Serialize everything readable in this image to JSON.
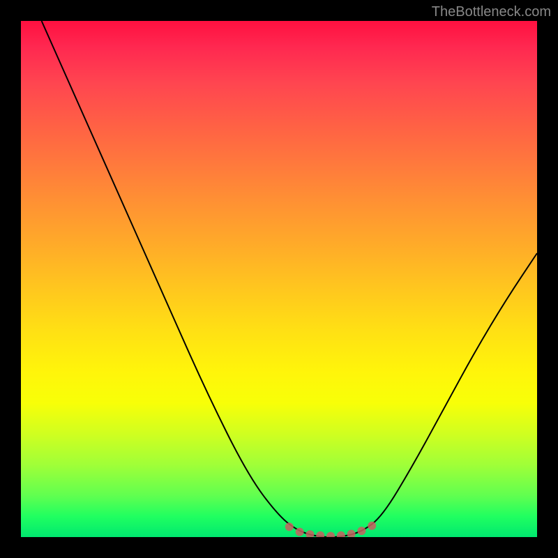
{
  "watermark": "TheBottleneck.com",
  "chart_data": {
    "type": "line",
    "title": "",
    "xlabel": "",
    "ylabel": "",
    "xlim": [
      0,
      100
    ],
    "ylim": [
      0,
      100
    ],
    "curve": {
      "name": "bottleneck-curve",
      "points": [
        {
          "x": 4,
          "y": 100
        },
        {
          "x": 12,
          "y": 82
        },
        {
          "x": 20,
          "y": 64
        },
        {
          "x": 28,
          "y": 46
        },
        {
          "x": 36,
          "y": 28
        },
        {
          "x": 44,
          "y": 12
        },
        {
          "x": 50,
          "y": 4
        },
        {
          "x": 54,
          "y": 1
        },
        {
          "x": 58,
          "y": 0
        },
        {
          "x": 62,
          "y": 0
        },
        {
          "x": 66,
          "y": 1
        },
        {
          "x": 70,
          "y": 4
        },
        {
          "x": 76,
          "y": 14
        },
        {
          "x": 82,
          "y": 25
        },
        {
          "x": 88,
          "y": 36
        },
        {
          "x": 94,
          "y": 46
        },
        {
          "x": 100,
          "y": 55
        }
      ]
    },
    "optimal_zone": {
      "start_x": 52,
      "end_x": 68,
      "y": 0
    },
    "dots": [
      {
        "x": 52,
        "y": 2
      },
      {
        "x": 54,
        "y": 1
      },
      {
        "x": 56,
        "y": 0.5
      },
      {
        "x": 58,
        "y": 0.3
      },
      {
        "x": 60,
        "y": 0.2
      },
      {
        "x": 62,
        "y": 0.3
      },
      {
        "x": 64,
        "y": 0.6
      },
      {
        "x": 66,
        "y": 1.2
      },
      {
        "x": 68,
        "y": 2.2
      }
    ]
  }
}
